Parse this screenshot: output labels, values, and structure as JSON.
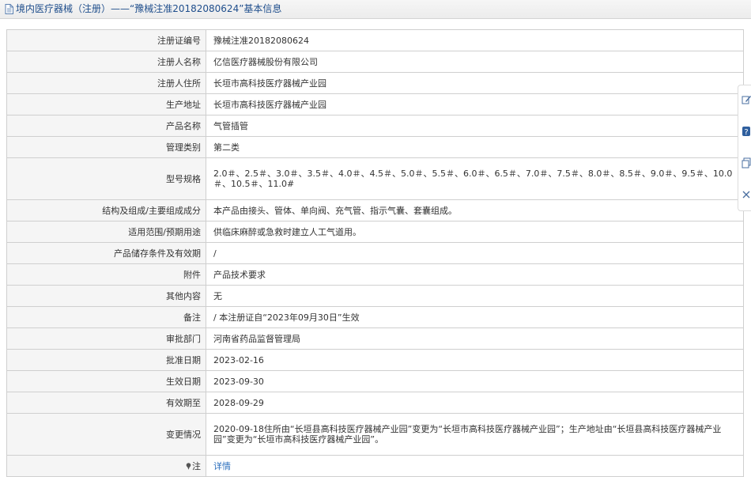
{
  "header": {
    "title": "境内医疗器械（注册）——“豫械注准20182080624”基本信息"
  },
  "rows": [
    {
      "label": "注册证编号",
      "value": "豫械注准20182080624"
    },
    {
      "label": "注册人名称",
      "value": "亿信医疗器械股份有限公司"
    },
    {
      "label": "注册人住所",
      "value": "长垣市高科技医疗器械产业园"
    },
    {
      "label": "生产地址",
      "value": "长垣市高科技医疗器械产业园"
    },
    {
      "label": "产品名称",
      "value": "气管插管"
    },
    {
      "label": "管理类别",
      "value": "第二类"
    },
    {
      "label": "型号规格",
      "value": "2.0＃、2.5＃、3.0＃、3.5＃、4.0＃、4.5＃、5.0＃、5.5＃、6.0＃、6.5＃、7.0＃、7.5＃、8.0＃、8.5＃、9.0＃、9.5＃、10.0＃、10.5＃、11.0#"
    },
    {
      "label": "结构及组成/主要组成成分",
      "value": "本产品由接头、管体、单向阀、充气管、指示气囊、套囊组成。"
    },
    {
      "label": "适用范围/预期用途",
      "value": "供临床麻醉或急救时建立人工气道用。"
    },
    {
      "label": "产品储存条件及有效期",
      "value": "/"
    },
    {
      "label": "附件",
      "value": "产品技术要求"
    },
    {
      "label": "其他内容",
      "value": "无"
    },
    {
      "label": "备注",
      "value": "/ 本注册证自“2023年09月30日”生效"
    },
    {
      "label": "审批部门",
      "value": "河南省药品监督管理局"
    },
    {
      "label": "批准日期",
      "value": "2023-02-16"
    },
    {
      "label": "生效日期",
      "value": "2023-09-30"
    },
    {
      "label": "有效期至",
      "value": "2028-09-29"
    },
    {
      "label": "变更情况",
      "value": "2020-09-18住所由“长垣县高科技医疗器械产业园”变更为“长垣市高科技医疗器械产业园”；生产地址由“长垣县高科技医疗器械产业园”变更为“长垣市高科技医疗器械产业园”。"
    },
    {
      "label": "注",
      "value": "详情"
    }
  ],
  "icons": {
    "header": "document-icon",
    "note": "pin-icon",
    "toolbar": [
      "edit-icon",
      "help-icon",
      "copy-icon",
      "close-icon"
    ]
  },
  "colors": {
    "title": "#1f4e8c",
    "link": "#2a6ebd",
    "label_bg": "#f5f5f5",
    "border": "#cfcfcf"
  }
}
